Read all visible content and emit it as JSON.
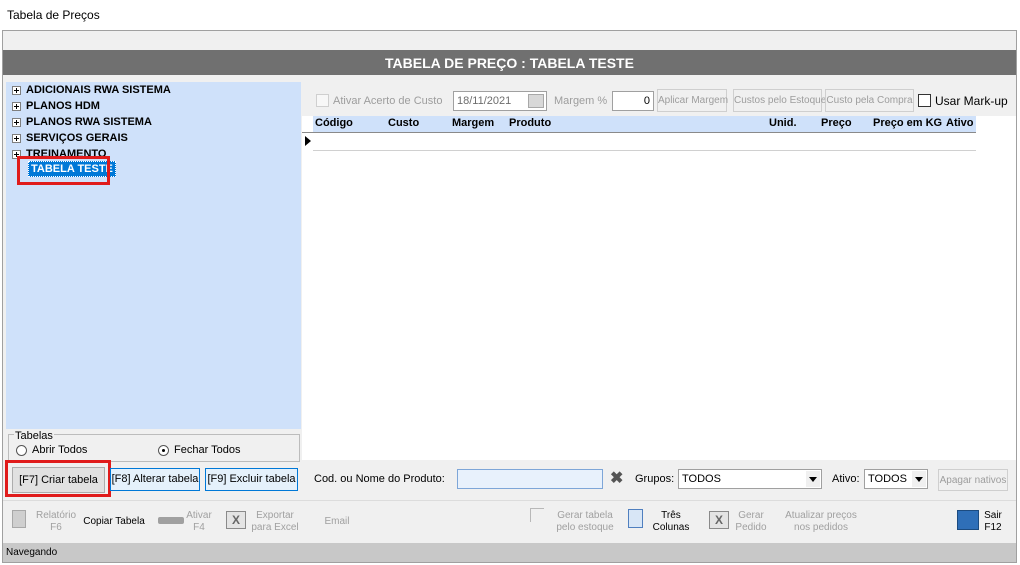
{
  "window": {
    "title": "Tabela de Preços"
  },
  "header": {
    "title": "TABELA DE PREÇO : TABELA TESTE"
  },
  "tree": {
    "items": [
      {
        "label": "ADICIONAIS RWA SISTEMA"
      },
      {
        "label": "PLANOS HDM"
      },
      {
        "label": "PLANOS RWA SISTEMA"
      },
      {
        "label": "SERVIÇOS GERAIS"
      },
      {
        "label": "TREINAMENTO"
      }
    ],
    "selected": "TABELA TESTE"
  },
  "tabelas_group": {
    "legend": "Tabelas",
    "abrir_label": "Abrir Todos",
    "fechar_label": "Fechar Todos",
    "selected": "Fechar Todos"
  },
  "table_buttons": {
    "criar": "[F7] Criar tabela",
    "alterar": "[F8] Alterar tabela",
    "excluir": "[F9] Excluir tabela"
  },
  "top_controls": {
    "ativar_acerto_label": "Ativar Acerto de Custo",
    "date_value": "18/11/2021",
    "margem_label": "Margem %",
    "margem_value": "0",
    "aplicar_margem": "Aplicar Margem",
    "custos_estoque": "Custos pelo Estoque",
    "custo_compra": "Custo pela Compra",
    "usar_markup_label": "Usar Mark-up"
  },
  "grid": {
    "columns": [
      "Código",
      "Custo",
      "Margem",
      "Produto",
      "Unid.",
      "Preço",
      "Preço em KG",
      "Ativo"
    ]
  },
  "filters": {
    "cod_nome_label": "Cod. ou Nome do Produto:",
    "cod_nome_value": "",
    "grupos_label": "Grupos:",
    "grupos_value": "TODOS",
    "ativo_label": "Ativo:",
    "ativo_value": "TODOS",
    "apagar_nativos": "Apagar nativos"
  },
  "bottom_toolbar": {
    "relatorio": [
      "Relatório",
      "F6"
    ],
    "copiar_tabela": "Copiar Tabela",
    "ativar": [
      "Ativar",
      "F4"
    ],
    "exportar": [
      "Exportar",
      "para Excel"
    ],
    "email": "Email",
    "gerar_tabela_estoque": [
      "Gerar tabela",
      "pelo estoque"
    ],
    "tres_colunas": [
      "Três",
      "Colunas"
    ],
    "gerar_pedido": [
      "Gerar",
      "Pedido"
    ],
    "atualizar_precos": [
      "Atualizar preços",
      "nos pedidos"
    ],
    "sair": [
      "Sair",
      "F12"
    ]
  },
  "status": {
    "text": "Navegando"
  },
  "colors": {
    "header_bg": "#707070",
    "tree_bg": "#cfe1fa",
    "selection": "#0078d7",
    "highlight": "#e01b1b"
  }
}
